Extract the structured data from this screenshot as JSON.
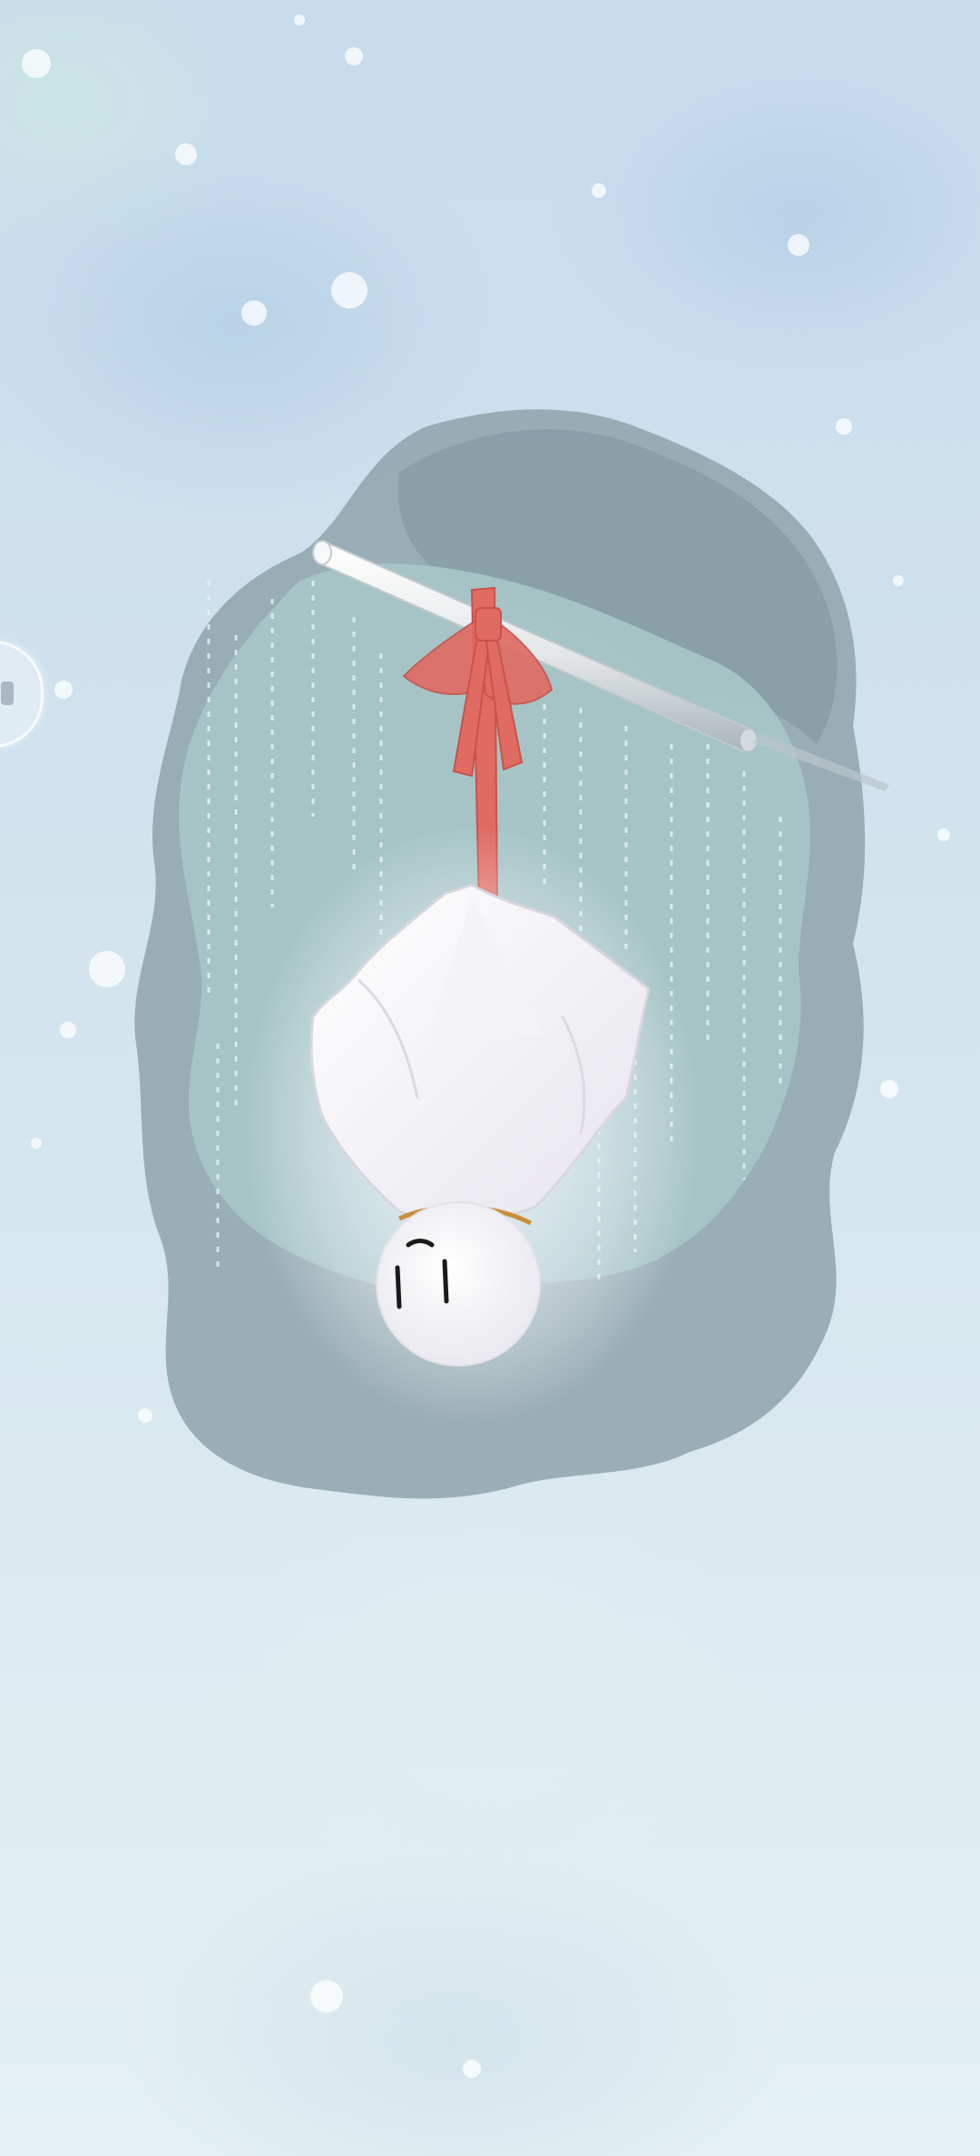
{
  "screen": {
    "type": "mobile-wallpaper",
    "palette": {
      "sky_top": "#c7dced",
      "sky_bottom": "#e4f0f2",
      "ink_wash": "#8ea6ae",
      "teal_wash": "#a9c9c9",
      "ribbon": "#e06b62",
      "doll_body": "#fbfbfd",
      "collar": "#c98f3b",
      "face_marks": "#1a1a1a"
    }
  },
  "illustration": {
    "subject": "teru-teru-bozu-doll",
    "hanging_from": "eave-pole",
    "effects": [
      "ink-wash-backdrop",
      "rain-streaks",
      "snow-dots",
      "soft-glow"
    ]
  },
  "side_handle": {
    "icon": "edge-panel-handle-icon"
  }
}
